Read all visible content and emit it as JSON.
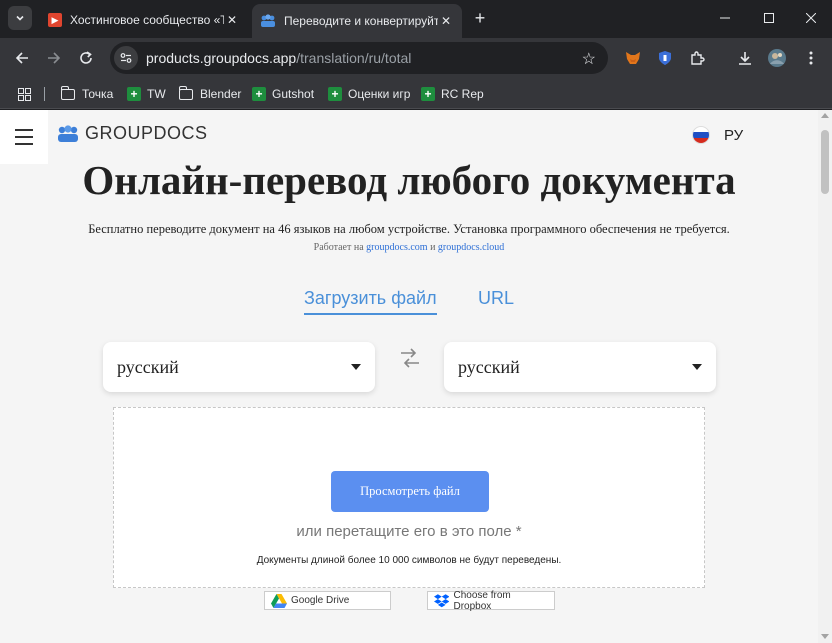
{
  "browser": {
    "tabs": [
      {
        "title": "Хостинговое сообщество «Tim",
        "active": false
      },
      {
        "title": "Переводите и конвертируйте",
        "active": true
      }
    ],
    "url": {
      "host": "products.groupdocs.app",
      "path": "/translation/ru/total"
    },
    "bookmarks": [
      {
        "label": "Точка",
        "icon": "folder-icon"
      },
      {
        "label": "TW",
        "icon": "green-plus-icon"
      },
      {
        "label": "Blender",
        "icon": "folder-icon"
      },
      {
        "label": "Gutshot",
        "icon": "green-plus-icon"
      },
      {
        "label": "Оценки игр",
        "icon": "green-plus-icon"
      },
      {
        "label": "RC Rep",
        "icon": "green-plus-icon"
      }
    ],
    "colors": {
      "frame": "#202124",
      "toolbar": "#35363a",
      "text": "#e8eaed"
    }
  },
  "page": {
    "logo": "GROUPDOCS",
    "language": "РУ",
    "title": "Онлайн-перевод любого документа",
    "subtitle": "Бесплатно переводите документ на 46 языков на любом устройстве. Установка программного обеспечения не требуется.",
    "powered_prefix": "Работает на",
    "powered_link1": "groupdocs.com",
    "powered_and": "и",
    "powered_link2": "groupdocs.cloud",
    "tabs": {
      "upload": "Загрузить файл",
      "url": "URL"
    },
    "source_language": "русский",
    "target_language": "русский",
    "browse_button": "Просмотреть файл",
    "drop_hint": "или перетащите его в это поле *",
    "drop_note": "Документы длиной более 10 000 символов не будут переведены.",
    "google_drive": "Google Drive",
    "dropbox": "Choose from Dropbox",
    "colors": {
      "accent": "#4a90d9",
      "button": "#5b8ff0",
      "background": "#f5f5f5"
    }
  }
}
